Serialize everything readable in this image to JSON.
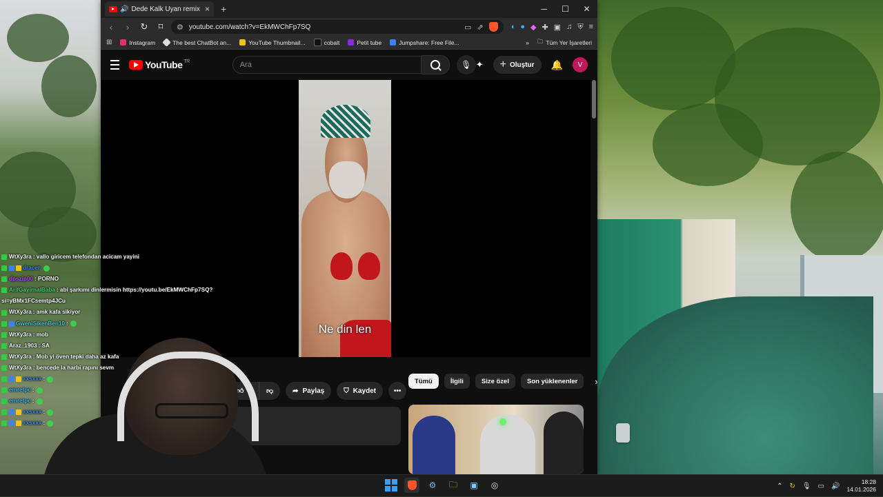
{
  "browser": {
    "tab_title": "Dede Kalk Uyan remix - YouTube",
    "new_tab": "+",
    "window_controls": [
      "─",
      "☐",
      "✕"
    ],
    "url": "youtube.com/watch?v=EkMWChFp7SQ",
    "bookmarks": [
      {
        "label": "Instagram",
        "color": "#e1306c"
      },
      {
        "label": "The best ChatBot an...",
        "color": "#dddddd"
      },
      {
        "label": "YouTube Thumbnail...",
        "color": "#f4c20d"
      },
      {
        "label": "cobalt",
        "color": "#111111"
      },
      {
        "label": "Petit tube",
        "color": "#8a2be2"
      },
      {
        "label": "Jumpshare: Free File...",
        "color": "#3b82f6"
      }
    ],
    "bookmarks_overflow": "»",
    "all_bookmarks": "Tüm Yer İşaretleri"
  },
  "youtube": {
    "logo_text": "YouTube",
    "logo_region": "TR",
    "search_placeholder": "Ara",
    "create_label": "Oluştur",
    "avatar_letter": "V",
    "video_subtitle": "Ne din len",
    "like_count": "2",
    "share_label": "Paylaş",
    "save_label": "Kaydet",
    "chips": [
      "Tümü",
      "İlgili",
      "Size özel",
      "Son yüklenenler"
    ]
  },
  "chat": [
    {
      "user": "WtXy3ra",
      "msg": ": vallo giricem telefondan acicam yayini",
      "color": "u-white",
      "badges": 1
    },
    {
      "user": "dracer",
      "msg": "",
      "color": "u-blue",
      "badges": 3,
      "emote": true
    },
    {
      "user": "dpszip00",
      "msg": ": PORNO",
      "color": "u-purple",
      "badges": 1
    },
    {
      "user": "ArifGayirnalBaba",
      "msg": ": abi şarkımı dinlermisin https://youtu.be/EkMWChFp7SQ?",
      "color": "u-green",
      "badges": 1
    },
    {
      "user": "",
      "msg": "si=yBMx1FCsemtp4JCu",
      "color": "u-white",
      "badges": 0
    },
    {
      "user": "WtXy3ra",
      "msg": ": amk kafa sikiyor",
      "color": "u-white",
      "badges": 1
    },
    {
      "user": "GweniSikenBen10",
      "msg": ":",
      "color": "u-teal",
      "badges": 2,
      "emote": true
    },
    {
      "user": "WtXy3ra",
      "msg": ": mob",
      "color": "u-white",
      "badges": 1
    },
    {
      "user": "Araz_1903",
      "msg": ": SA",
      "color": "u-white",
      "badges": 1
    },
    {
      "user": "WtXy3ra",
      "msg": ": Mob yi öven tepki daha az kafa",
      "color": "u-white",
      "badges": 1
    },
    {
      "user": "WtXy3ra",
      "msg": ": bencede la harbi rapını sevm",
      "color": "u-white",
      "badges": 1
    },
    {
      "user": "xxsxxx",
      "msg": ":",
      "color": "u-blue",
      "badges": 3,
      "emote": true
    },
    {
      "user": "emretpc",
      "msg": ":",
      "color": "u-cyan",
      "badges": 1,
      "emote": true
    },
    {
      "user": "emretpc",
      "msg": ":",
      "color": "u-cyan",
      "badges": 1,
      "emote": true
    },
    {
      "user": "xxsxxx",
      "msg": ":",
      "color": "u-blue",
      "badges": 3,
      "emote": true
    },
    {
      "user": "xxsxxx",
      "msg": ":",
      "color": "u-blue",
      "badges": 3,
      "emote": true
    }
  ],
  "taskbar": {
    "time": "18:28",
    "date": "14.01.2026"
  }
}
